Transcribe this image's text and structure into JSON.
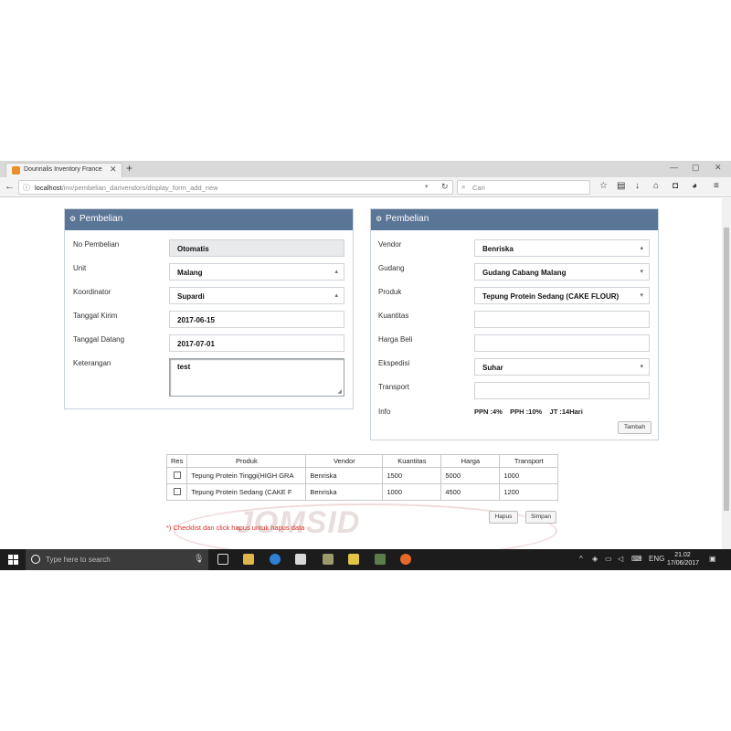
{
  "browser": {
    "tab_title": "Dounnalis Inventory France",
    "tab_close": "✕",
    "new_tab": "+",
    "url_host": "localhost",
    "url_path": "/inv/pembelian_darivendors/display_form_add_new",
    "search_placeholder": "Cari",
    "win_min": "—",
    "win_max": "▢",
    "win_close": "✕"
  },
  "left_panel": {
    "title": "Pembelian",
    "fields": {
      "no_pembelian": {
        "label": "No Pembelian",
        "value": "Otomatis"
      },
      "unit": {
        "label": "Unit",
        "value": "Malang"
      },
      "koordinator": {
        "label": "Koordinator",
        "value": "Supardi"
      },
      "tanggal_kirim": {
        "label": "Tanggal Kirim",
        "value": "2017-06-15"
      },
      "tanggal_datang": {
        "label": "Tanggal Datang",
        "value": "2017-07-01"
      },
      "keterangan": {
        "label": "Keterangan",
        "value": "test"
      }
    }
  },
  "right_panel": {
    "title": "Pembelian",
    "fields": {
      "vendor": {
        "label": "Vendor",
        "value": "Benriska"
      },
      "gudang": {
        "label": "Gudang",
        "value": "Gudang Cabang Malang"
      },
      "produk": {
        "label": "Produk",
        "value": "Tepung Protein Sedang (CAKE FLOUR)"
      },
      "kuantitas": {
        "label": "Kuantitas",
        "value": ""
      },
      "harga_beli": {
        "label": "Harga Beli",
        "value": ""
      },
      "ekspedisi": {
        "label": "Ekspedisi",
        "value": "Suhar"
      },
      "transport": {
        "label": "Transport",
        "value": ""
      },
      "info": {
        "label": "Info",
        "value": "PPN :4%    PPH :10%    JT :14Hari"
      }
    },
    "tambah_label": "Tambah"
  },
  "table": {
    "headers": [
      "Res",
      "Produk",
      "Vendor",
      "Kuantitas",
      "Harga",
      "Transport"
    ],
    "rows": [
      {
        "produk": "Tepung Protein Tinggi(HIGH GRA",
        "vendor": "Benriska",
        "kuantitas": "1500",
        "harga": "5000",
        "transport": "1000"
      },
      {
        "produk": "Tepung Protein Sedang (CAKE F",
        "vendor": "Benriska",
        "kuantitas": "1000",
        "harga": "4500",
        "transport": "1200"
      }
    ]
  },
  "actions": {
    "hapus_label": "Hapus",
    "simpan_label": "Simpan"
  },
  "note": "*) Checklist dan click hapus untuk hapus data",
  "watermark": "JOMSID",
  "taskbar": {
    "search_placeholder": "Type here to search",
    "lang": "ENG",
    "time": "21.02",
    "date": "17/06/2017"
  },
  "colors": {
    "panel_header": "#5b7597",
    "note": "#d93025",
    "taskbar": "#1c1c1c"
  }
}
